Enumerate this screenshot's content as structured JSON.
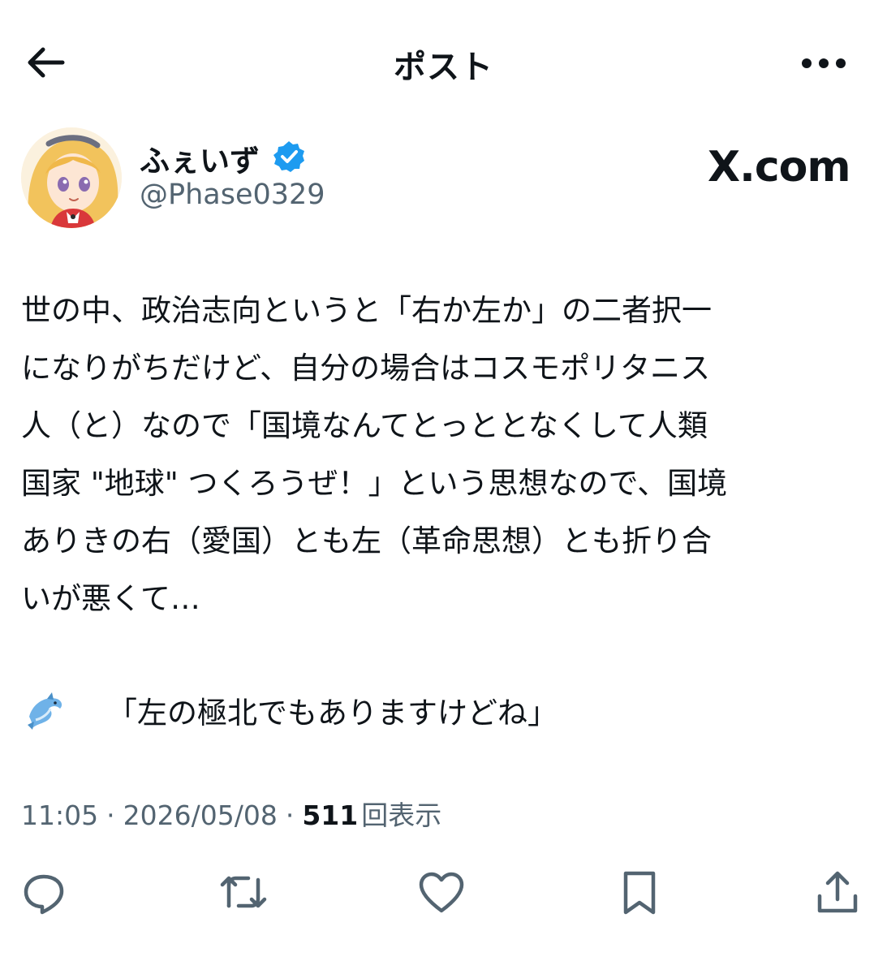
{
  "header": {
    "title": "ポスト",
    "back_icon": "arrow-left-icon",
    "more_icon": "more-horizontal-icon"
  },
  "author": {
    "display_name": "ふぇいず",
    "handle": "@Phase0329",
    "verified": true,
    "verified_color": "#1d9bf0"
  },
  "watermark": "X.com",
  "post": {
    "text": "世の中、政治志向というと「右か左か」の二者択一\nになりがちだけど、自分の場合はコスモポリタニス\n人（と）なので「国境なんてとっととなくして人類\n国家 \"地球\" つくろうぜ！」という思想なので、国境\nありきの右（愛国）とも左（革命思想）とも折り合\nいが悪くて…",
    "reply_quote": "「左の極北でもありますけどね」",
    "emoji_icon": "dolphin-icon"
  },
  "meta": {
    "time": "11:05",
    "separator": "·",
    "date": "2026/05/08",
    "views_count": "511",
    "views_label": "回表示"
  },
  "actions": [
    {
      "name": "reply",
      "icon": "reply-icon"
    },
    {
      "name": "repost",
      "icon": "repost-icon"
    },
    {
      "name": "like",
      "icon": "heart-icon"
    },
    {
      "name": "bookmark",
      "icon": "bookmark-icon"
    },
    {
      "name": "share",
      "icon": "share-icon"
    }
  ],
  "colors": {
    "text_primary": "#0f1419",
    "text_secondary": "#536471",
    "background": "#ffffff"
  }
}
